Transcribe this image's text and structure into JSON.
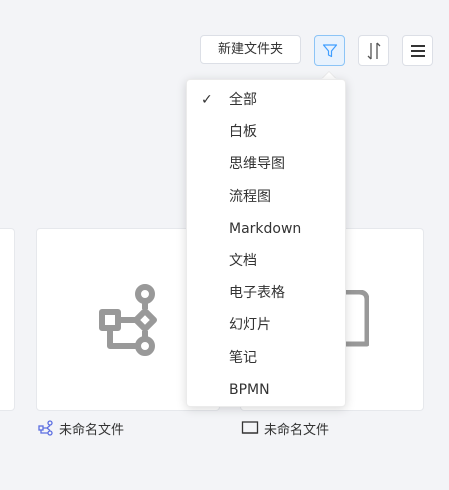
{
  "toolbar": {
    "new_folder_label": "新建文件夹",
    "filter_icon": "filter-icon",
    "sort_icon": "sort-icon",
    "menu_icon": "menu-icon",
    "accent_color": "#409eff"
  },
  "filter_menu": {
    "selected_mark": "✓",
    "items": [
      {
        "label": "全部",
        "selected": true
      },
      {
        "label": "白板",
        "selected": false
      },
      {
        "label": "思维导图",
        "selected": false
      },
      {
        "label": "流程图",
        "selected": false
      },
      {
        "label": "Markdown",
        "selected": false
      },
      {
        "label": "文档",
        "selected": false
      },
      {
        "label": "电子表格",
        "selected": false
      },
      {
        "label": "幻灯片",
        "selected": false
      },
      {
        "label": "笔记",
        "selected": false
      },
      {
        "label": "BPMN",
        "selected": false
      }
    ]
  },
  "files": [
    {
      "name": "未命名文件",
      "type_icon": "flowchart-icon",
      "icon_color": "#5b6ee1"
    },
    {
      "name": "未命名文件",
      "type_icon": "document-icon",
      "icon_color": "#333333"
    }
  ]
}
